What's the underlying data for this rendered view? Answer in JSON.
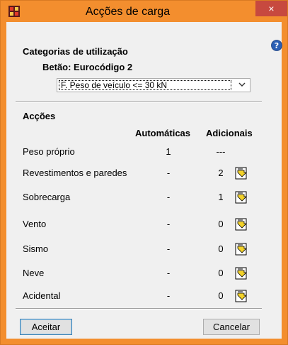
{
  "window": {
    "title": "Acções de carga",
    "close_glyph": "×"
  },
  "usage": {
    "heading": "Categorias de utilização",
    "subheading": "Betão: Eurocódigo 2",
    "selected_category": "F. Peso de veículo <= 30 kN"
  },
  "actions": {
    "heading": "Acções",
    "col_auto": "Automáticas",
    "col_add": "Adicionais",
    "rows": [
      {
        "label": "Peso próprio",
        "auto": "1",
        "add": "---"
      },
      {
        "label": "Revestimentos e paredes",
        "auto": "-",
        "add": "2"
      },
      {
        "label": "Sobrecarga",
        "auto": "-",
        "add": "1"
      },
      {
        "label": "Vento",
        "auto": "-",
        "add": "0"
      },
      {
        "label": "Sismo",
        "auto": "-",
        "add": "0"
      },
      {
        "label": "Neve",
        "auto": "-",
        "add": "0"
      },
      {
        "label": "Acidental",
        "auto": "-",
        "add": "0"
      }
    ]
  },
  "buttons": {
    "accept": "Aceitar",
    "cancel": "Cancelar"
  },
  "icons": {
    "app": "app-icon",
    "help": "help-icon",
    "close": "close-icon",
    "edit": "edit-list-icon",
    "dropdown": "chevron-down-icon"
  },
  "colors": {
    "title_bar": "#f38e2e",
    "close_button": "#c7493f",
    "client": "#f0f0f0"
  }
}
